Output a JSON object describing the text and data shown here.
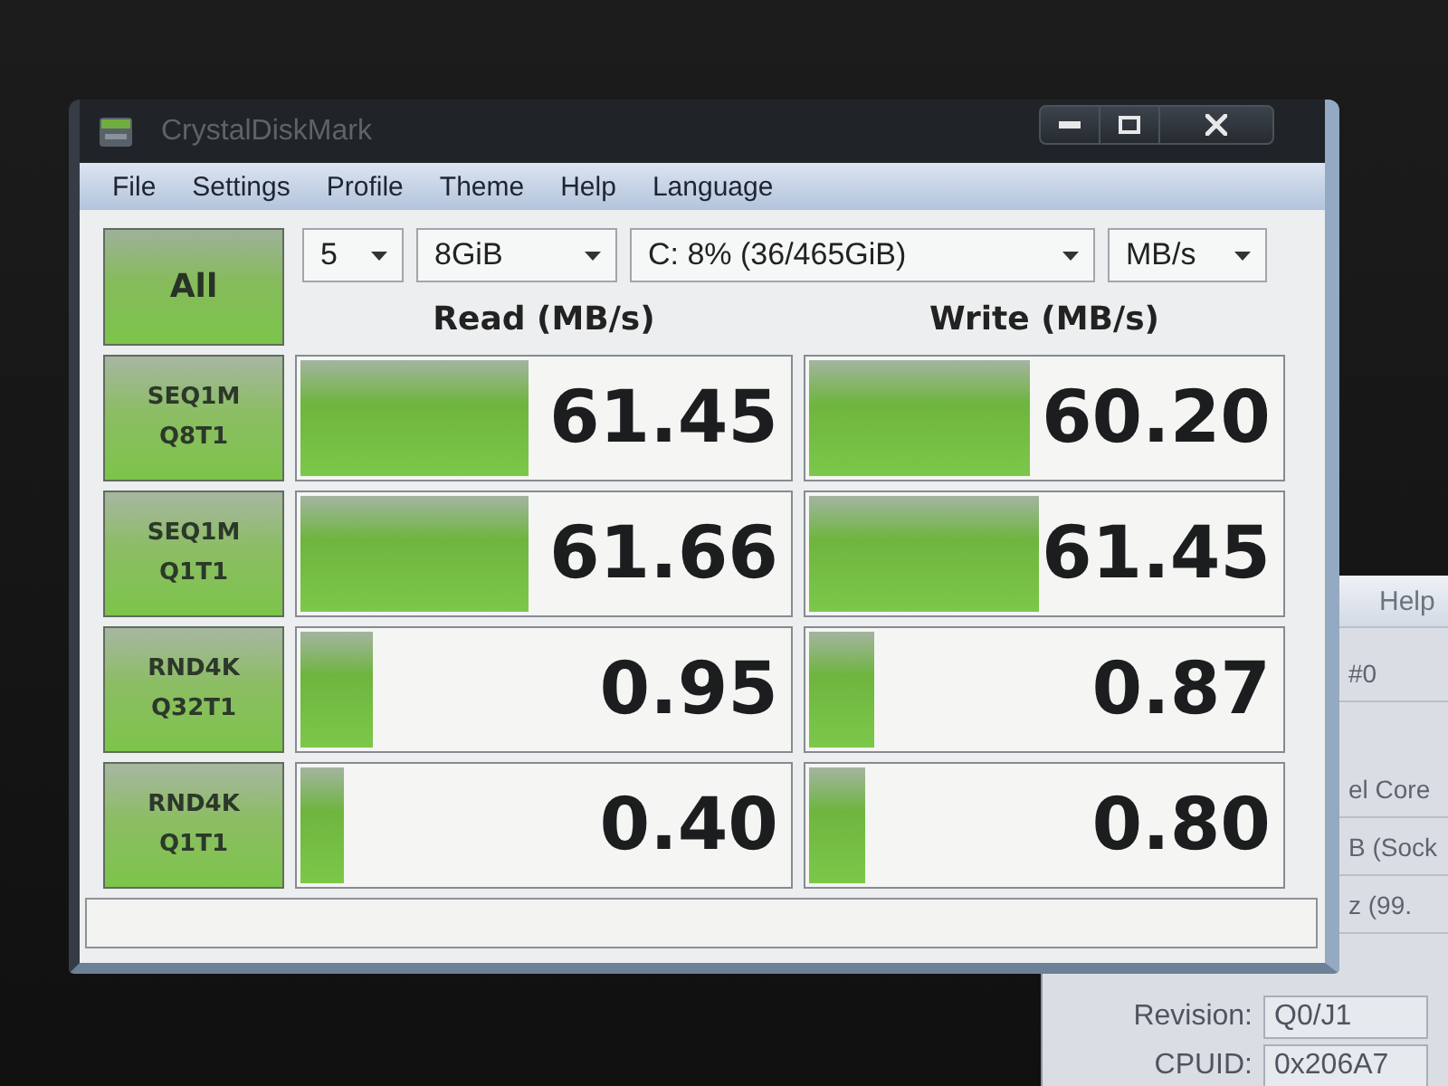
{
  "window": {
    "title": "CrystalDiskMark"
  },
  "menu": [
    "File",
    "Settings",
    "Profile",
    "Theme",
    "Help",
    "Language"
  ],
  "run_all": "All",
  "selectors": [
    {
      "value": "5"
    },
    {
      "value": "8GiB"
    },
    {
      "value": "C: 8% (36/465GiB)"
    },
    {
      "value": "MB/s"
    }
  ],
  "headers": {
    "read": "Read (MB/s)",
    "write": "Write (MB/s)"
  },
  "tests": [
    {
      "name": "SEQ1M",
      "params": "Q8T1",
      "read": {
        "value": "61.45",
        "level": 0.47
      },
      "write": {
        "value": "60.20",
        "level": 0.47
      }
    },
    {
      "name": "SEQ1M",
      "params": "Q1T1",
      "read": {
        "value": "61.66",
        "level": 0.47
      },
      "write": {
        "value": "61.45",
        "level": 0.49
      }
    },
    {
      "name": "RND4K",
      "params": "Q32T1",
      "read": {
        "value": "0.95",
        "level": 0.15
      },
      "write": {
        "value": "0.87",
        "level": 0.14
      }
    },
    {
      "name": "RND4K",
      "params": "Q1T1",
      "read": {
        "value": "0.40",
        "level": 0.09
      },
      "write": {
        "value": "0.80",
        "level": 0.12
      }
    }
  ],
  "background_window": {
    "menu": [
      "Help"
    ],
    "rows": [
      "#0",
      "el Core",
      "B (Sock",
      "z (99."
    ],
    "fields": [
      {
        "label": "Revision:",
        "value": "Q0/J1"
      },
      {
        "label": "CPUID:",
        "value": "0x206A7"
      }
    ]
  }
}
